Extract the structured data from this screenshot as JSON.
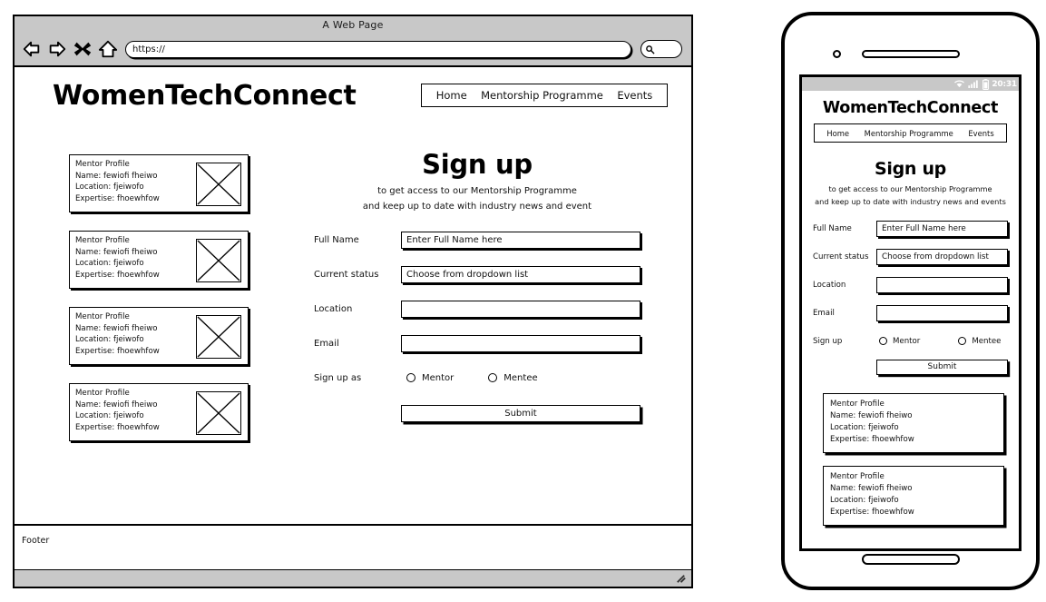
{
  "browser": {
    "window_title": "A Web Page",
    "url_value": "https://",
    "icons": {
      "back": "back-arrow-icon",
      "forward": "forward-arrow-icon",
      "stop": "close-x-icon",
      "home": "home-icon",
      "search": "search-icon",
      "resize_grip": "resize-grip-icon"
    }
  },
  "desktop": {
    "site_title": "WomenTechConnect",
    "nav": [
      {
        "label": "Home"
      },
      {
        "label": "Mentorship Programme"
      },
      {
        "label": "Events"
      }
    ],
    "mentor_cards": [
      {
        "heading": "Mentor Profile",
        "name": "Name: fewiofi fheiwo",
        "location": "Location: fjeiwofo",
        "expertise": "Expertise: fhoewhfow"
      },
      {
        "heading": "Mentor Profile",
        "name": "Name: fewiofi fheiwo",
        "location": "Location: fjeiwofo",
        "expertise": "Expertise: fhoewhfow"
      },
      {
        "heading": "Mentor Profile",
        "name": "Name: fewiofi fheiwo",
        "location": "Location: fjeiwofo",
        "expertise": "Expertise: fhoewhfow"
      },
      {
        "heading": "Mentor Profile",
        "name": "Name: fewiofi fheiwo",
        "location": "Location: fjeiwofo",
        "expertise": "Expertise: fhoewhfow"
      }
    ],
    "signup": {
      "title": "Sign up",
      "subtitle_line1": "to get access to our Mentorship Programme",
      "subtitle_line2": "and keep up to date with industry news and event",
      "fields": {
        "full_name_label": "Full Name",
        "full_name_placeholder": "Enter Full Name here",
        "status_label": "Current status",
        "status_placeholder": "Choose from dropdown list",
        "location_label": "Location",
        "location_value": "",
        "email_label": "Email",
        "email_value": "",
        "role_label": "Sign up as",
        "role_option_1": "Mentor",
        "role_option_2": "Mentee"
      },
      "submit_label": "Submit"
    },
    "footer_label": "Footer"
  },
  "mobile": {
    "status": {
      "clock": "20:31",
      "wifi": "wifi-icon",
      "signal": "signal-bars-icon",
      "battery": "battery-icon"
    },
    "site_title": "WomenTechConnect",
    "nav": [
      {
        "label": "Home"
      },
      {
        "label": "Mentorship Programme"
      },
      {
        "label": "Events"
      }
    ],
    "signup": {
      "title": "Sign up",
      "subtitle_line1": "to get access to our Mentorship Programme",
      "subtitle_line2": "and keep up to date with industry news and events",
      "fields": {
        "full_name_label": "Full Name",
        "full_name_placeholder": "Enter Full Name here",
        "status_label": "Current status",
        "status_placeholder": "Choose from dropdown list",
        "location_label": "Location",
        "location_value": "",
        "email_label": "Email",
        "email_value": "",
        "role_label": "Sign up",
        "role_option_1": "Mentor",
        "role_option_2": "Mentee"
      },
      "submit_label": "Submit"
    },
    "mentor_cards": [
      {
        "heading": "Mentor Profile",
        "name": "Name: fewiofi fheiwo",
        "location": "Location: fjeiwofo",
        "expertise": "Expertise: fhoewhfow"
      },
      {
        "heading": "Mentor Profile",
        "name": "Name: fewiofi fheiwo",
        "location": "Location: fjeiwofo",
        "expertise": "Expertise: fhoewhfow"
      }
    ]
  },
  "colors": {
    "chrome_gray": "#c8c8c8",
    "line_black": "#000000",
    "page_white": "#ffffff"
  }
}
